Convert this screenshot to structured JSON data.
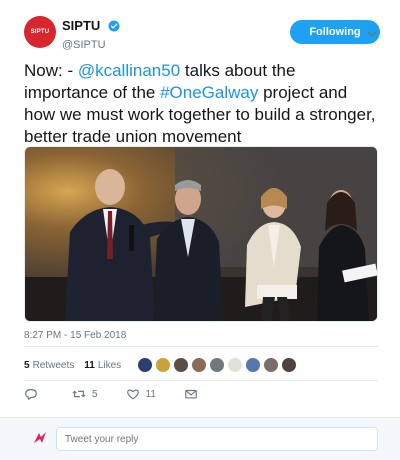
{
  "author": {
    "display_name": "SIPTU",
    "handle": "@SIPTU",
    "avatar_text": "SIPTU",
    "verified": true
  },
  "follow_button": {
    "label": "Following"
  },
  "tweet": {
    "text_prefix": "Now: - ",
    "mention": "@kcallinan50",
    "text_middle": " talks about the importance of the ",
    "hashtag": "#OneGalway",
    "text_suffix": " project and how we must work together to build a stronger, better trade union movement",
    "timestamp": "8:27 PM - 15 Feb 2018"
  },
  "stats": {
    "retweets_count": "5",
    "retweets_label": "Retweets",
    "likes_count": "11",
    "likes_label": "Likes"
  },
  "actions": {
    "retweet_count": "5",
    "like_count": "11"
  },
  "reply": {
    "placeholder": "Tweet your reply"
  },
  "colors": {
    "brand_blue": "#1da1f2",
    "link_blue": "#1b95e0",
    "siptu_red": "#d8262f"
  }
}
